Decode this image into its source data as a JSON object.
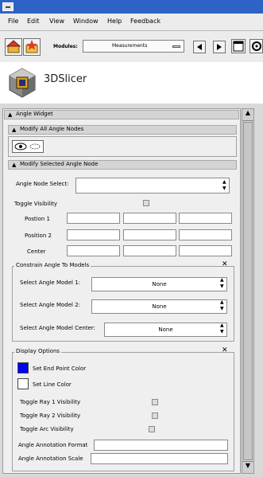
{
  "menubar": {
    "items": [
      "File",
      "Edit",
      "View",
      "Window",
      "Help",
      "Feedback"
    ]
  },
  "toolbar": {
    "modules_label": "Modules:",
    "modules_value": "Measurements"
  },
  "logo": {
    "text": "3DSlicer"
  },
  "panel": {
    "widget_title": "Angle Widget",
    "modify_all_title": "Modify All Angle Nodes",
    "modify_selected_title": "Modify Selected Angle Node",
    "node_select_label": "Angle Node Select:",
    "toggle_visibility_label": "Toggle Visibility",
    "position1_label": "Postion 1",
    "position2_label": "Position 2",
    "center_label": "Center",
    "constrain_title": "Constrain Angle To Models",
    "model1_label": "Select Angle Model 1:",
    "model1_value": "None",
    "model2_label": "Select Angle Model 2:",
    "model2_value": "None",
    "model_center_label": "Select Angle Model Center:",
    "model_center_value": "None",
    "display_options_title": "Display Options",
    "end_point_color_label": "Set End Point Color",
    "line_color_label": "Set Line Color",
    "toggle_ray1_label": "Toggle Ray 1 Visibility",
    "toggle_ray2_label": "Toggle Ray 2 Visibility",
    "toggle_arc_label": "Toggle Arc Visibility",
    "annotation_format_label": "Angle Annotation Format",
    "annotation_scale_label": "Angle Annotation Scale"
  },
  "colors": {
    "end_point_color": "#0000ff",
    "line_color": "#ffffff",
    "titlebar": "#2e62c4"
  }
}
